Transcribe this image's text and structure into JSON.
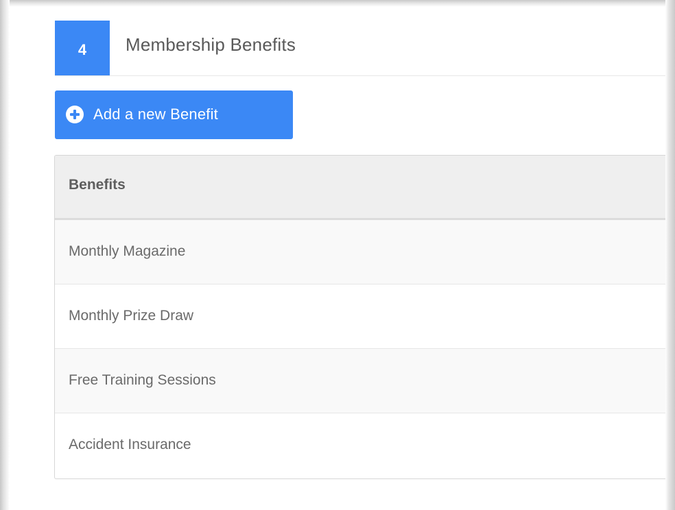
{
  "section": {
    "step_number": "4",
    "title": "Membership Benefits"
  },
  "add_button": {
    "label": "Add a new Benefit",
    "icon": "plus-circle-icon"
  },
  "table": {
    "header": "Benefits",
    "rows": [
      {
        "label": "Monthly Magazine"
      },
      {
        "label": "Monthly Prize Draw"
      },
      {
        "label": "Free Training Sessions"
      },
      {
        "label": "Accident Insurance"
      }
    ]
  },
  "colors": {
    "accent": "#3b88f5",
    "header_bg": "#efefef",
    "text": "#595959"
  }
}
